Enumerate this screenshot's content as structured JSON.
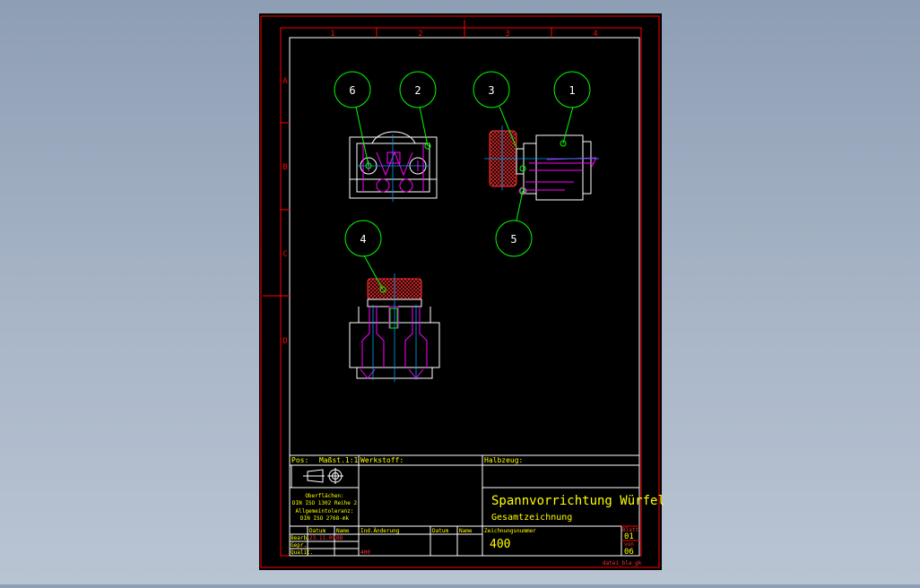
{
  "colors": {
    "background": "#000000",
    "frame": "#ff0000",
    "geometry": "#ffffff",
    "hidden": "#ff00ff",
    "centerline": "#00a0ff",
    "balloon": "#00ff00",
    "hatch": "#ff3030",
    "text": "#ffff00"
  },
  "frame": {
    "columns": [
      "1",
      "2",
      "3",
      "4"
    ],
    "rows": [
      "A",
      "B",
      "C",
      "D"
    ]
  },
  "balloons": [
    {
      "id": "balloon-6",
      "label": "6"
    },
    {
      "id": "balloon-2",
      "label": "2"
    },
    {
      "id": "balloon-3",
      "label": "3"
    },
    {
      "id": "balloon-1",
      "label": "1"
    },
    {
      "id": "balloon-4",
      "label": "4"
    },
    {
      "id": "balloon-5",
      "label": "5"
    }
  ],
  "title_block": {
    "pos_label": "Pos:",
    "scale_label": "Maßst.1:1",
    "material_label": "Werkstoff:",
    "semi_finished_label": "Halbzeug:",
    "surface_line1": "Oberflächen:",
    "surface_line2": "DIN ISO 1302 Reihe 2",
    "tolerance_line1": "Allgemeintoleranz:",
    "tolerance_line2": "DIN ISO 2768-mk",
    "title": "Spannvorrichtung  Würfel",
    "subtitle": "Gesamtzeichnung",
    "date_header": "Datum",
    "name_header": "Name",
    "change_header": "Ind.Änderung",
    "date_header2": "Datum",
    "name_header2": "Name",
    "drawing_no_label": "Zeichnungsnummer",
    "drawing_no": "400",
    "sheet_label": "Blatt",
    "sheet_value": "01",
    "of_label": "von",
    "total_value": "06",
    "row_bearb": "Bearb.",
    "row_gepr": "Gepr.",
    "row_quali": "Qualit.",
    "bearb_date": "23.11.09",
    "bearb_name": "BB",
    "change_index": "400",
    "filename": "datei_bla_gk"
  }
}
